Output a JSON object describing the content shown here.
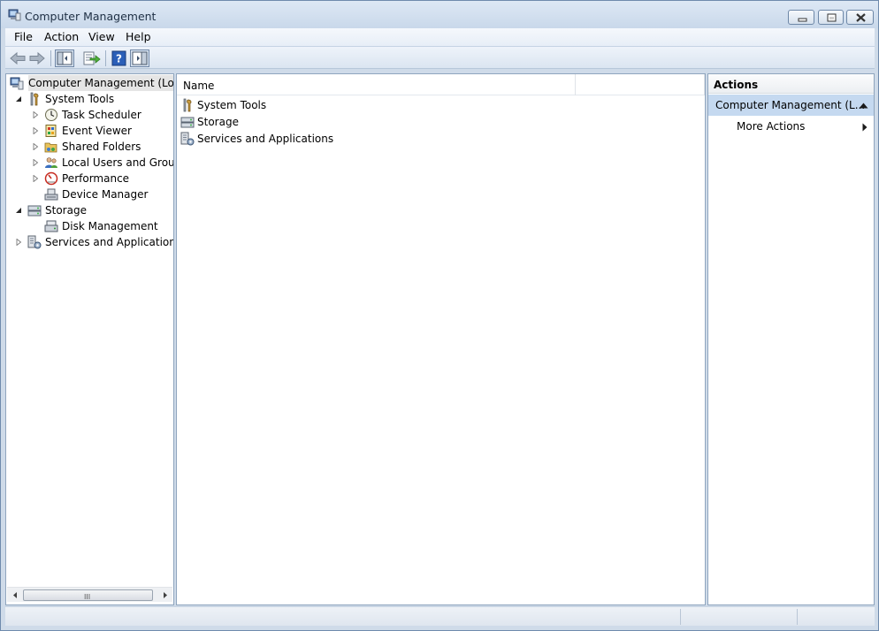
{
  "window": {
    "title": "Computer Management"
  },
  "menu": [
    "File",
    "Action",
    "View",
    "Help"
  ],
  "toolbar": {
    "buttons": [
      "back-arrow-icon",
      "forward-arrow-icon",
      "show-hide-console-tree-icon",
      "export-list-icon",
      "help-icon",
      "show-hide-action-pane-icon"
    ]
  },
  "tree": {
    "root": "Computer Management (Local",
    "items": [
      {
        "label": "System Tools",
        "level": 1,
        "expanded": true,
        "icon": "tools-icon"
      },
      {
        "label": "Task Scheduler",
        "level": 2,
        "expanded": false,
        "icon": "clock-icon"
      },
      {
        "label": "Event Viewer",
        "level": 2,
        "expanded": false,
        "icon": "event-viewer-icon"
      },
      {
        "label": "Shared Folders",
        "level": 2,
        "expanded": false,
        "icon": "shared-folder-icon"
      },
      {
        "label": "Local Users and Groups",
        "level": 2,
        "expanded": false,
        "icon": "users-icon"
      },
      {
        "label": "Performance",
        "level": 2,
        "expanded": false,
        "icon": "performance-icon"
      },
      {
        "label": "Device Manager",
        "level": 2,
        "expanded": null,
        "icon": "device-manager-icon"
      },
      {
        "label": "Storage",
        "level": 1,
        "expanded": true,
        "icon": "storage-icon"
      },
      {
        "label": "Disk Management",
        "level": 2,
        "expanded": null,
        "icon": "disk-icon"
      },
      {
        "label": "Services and Applications",
        "level": 1,
        "expanded": false,
        "icon": "services-icon"
      }
    ],
    "scroll_grip": "III"
  },
  "list": {
    "column_name": "Name",
    "rows": [
      {
        "label": "System Tools",
        "icon": "tools-icon"
      },
      {
        "label": "Storage",
        "icon": "storage-icon"
      },
      {
        "label": "Services and Applications",
        "icon": "services-icon"
      }
    ]
  },
  "actions": {
    "title": "Actions",
    "section": "Computer Management (L...",
    "items": [
      "More Actions"
    ]
  }
}
